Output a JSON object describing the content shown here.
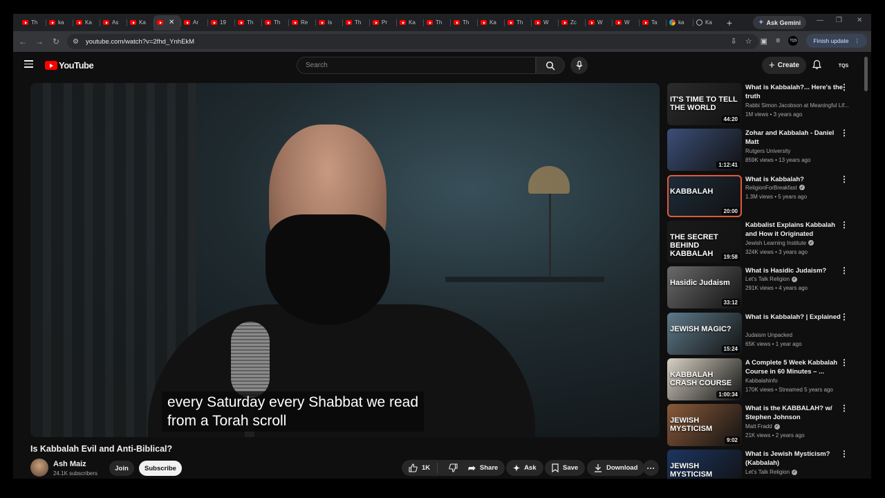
{
  "browser": {
    "tabs": [
      {
        "label": "Th",
        "icon": "youtube"
      },
      {
        "label": "ka",
        "icon": "youtube"
      },
      {
        "label": "Ka",
        "icon": "youtube"
      },
      {
        "label": "As",
        "icon": "youtube"
      },
      {
        "label": "Ka",
        "icon": "youtube"
      },
      {
        "label": "",
        "icon": "youtube",
        "active": true
      },
      {
        "label": "Ar",
        "icon": "youtube"
      },
      {
        "label": "19",
        "icon": "youtube"
      },
      {
        "label": "Th",
        "icon": "youtube"
      },
      {
        "label": "Th",
        "icon": "youtube"
      },
      {
        "label": "Re",
        "icon": "youtube"
      },
      {
        "label": "Is",
        "icon": "youtube"
      },
      {
        "label": "Th",
        "icon": "youtube"
      },
      {
        "label": "Pr",
        "icon": "youtube"
      },
      {
        "label": "Ka",
        "icon": "youtube"
      },
      {
        "label": "Th",
        "icon": "youtube"
      },
      {
        "label": "Th",
        "icon": "youtube"
      },
      {
        "label": "Ka",
        "icon": "youtube"
      },
      {
        "label": "Th",
        "icon": "youtube"
      },
      {
        "label": "W",
        "icon": "youtube"
      },
      {
        "label": "Zc",
        "icon": "youtube"
      },
      {
        "label": "W",
        "icon": "youtube"
      },
      {
        "label": "W",
        "icon": "youtube"
      },
      {
        "label": "Ta",
        "icon": "youtube"
      },
      {
        "label": "ka",
        "icon": "google"
      },
      {
        "label": "Ka",
        "icon": "web"
      }
    ],
    "gemini_label": "Ask Gemini",
    "url": "youtube.com/watch?v=2fhd_YnhEkM",
    "finish_update_label": "Finish update",
    "profile_initials": "TQS"
  },
  "youtube": {
    "logo_text": "YouTube",
    "search_placeholder": "Search",
    "create_label": "Create",
    "avatar_initials": "TQS"
  },
  "video": {
    "caption_line1": "every Saturday every Shabbat we read",
    "caption_line2": "from a Torah scroll",
    "title": "Is Kabbalah Evil and Anti-Biblical?",
    "channel_name": "Ash Maiz",
    "subscribers": "24.1K subscribers",
    "join_label": "Join",
    "subscribe_label": "Subscribe",
    "likes": "1K",
    "share_label": "Share",
    "ask_label": "Ask",
    "save_label": "Save",
    "download_label": "Download"
  },
  "recommendations": [
    {
      "title": "What is Kabbalah?... Here's the truth",
      "channel": "Rabbi Simon Jacobson at Meaningful Lif...",
      "verified": false,
      "meta": "1M views • 3 years ago",
      "duration": "44:20",
      "thumb_text": "IT'S TIME TO TELL THE WORLD",
      "thumb_color": "#2b2b2b"
    },
    {
      "title": "Zohar and Kabbalah - Daniel Matt",
      "channel": "Rutgers University",
      "verified": false,
      "meta": "859K views • 13 years ago",
      "duration": "1:12:41",
      "thumb_text": "",
      "thumb_color": "#3c4f78"
    },
    {
      "title": "What is Kabbalah?",
      "channel": "ReligionForBreakfast",
      "verified": true,
      "meta": "1.3M views • 5 years ago",
      "duration": "20:00",
      "thumb_text": "KABBALAH",
      "thumb_color": "#1e2c3a",
      "selected": true
    },
    {
      "title": "Kabbalist Explains Kabbalah and How it Originated",
      "channel": "Jewish Learning Institute",
      "verified": true,
      "meta": "324K views • 3 years ago",
      "duration": "19:58",
      "thumb_text": "THE SECRET BEHIND KABBALAH",
      "thumb_color": "#1a1a1a"
    },
    {
      "title": "What is Hasidic Judaism?",
      "channel": "Let's Talk Religion",
      "verified": true,
      "meta": "291K views • 4 years ago",
      "duration": "33:12",
      "thumb_text": "Hasidic Judaism",
      "thumb_color": "#6a6a6a"
    },
    {
      "title": "What is Kabbalah? | Explained",
      "channel": "Judaism Unpacked",
      "verified": false,
      "meta": "65K views • 1 year ago",
      "duration": "15:24",
      "thumb_text": "JEWISH MAGIC?",
      "thumb_color": "#5f7a8a"
    },
    {
      "title": "A Complete 5 Week Kabbalah Course in 60 Minutes – ...",
      "channel": "Kabbalahinfo",
      "verified": false,
      "meta": "170K views • Streamed 5 years ago",
      "duration": "1:00:34",
      "thumb_text": "KABBALAH CRASH COURSE",
      "thumb_color": "#d8d2c4"
    },
    {
      "title": "What is the KABBALAH? w/ Stephen Johnson",
      "channel": "Matt Fradd",
      "verified": true,
      "meta": "21K views • 2 years ago",
      "duration": "9:02",
      "thumb_text": "JEWISH MYSTICISM",
      "thumb_color": "#8a5a3a"
    },
    {
      "title": "What is Jewish Mysticism? (Kabbalah)",
      "channel": "Let's Talk Religion",
      "verified": true,
      "meta": "",
      "duration": "",
      "thumb_text": "JEWISH MYSTICISM",
      "thumb_color": "#1c3560"
    }
  ]
}
